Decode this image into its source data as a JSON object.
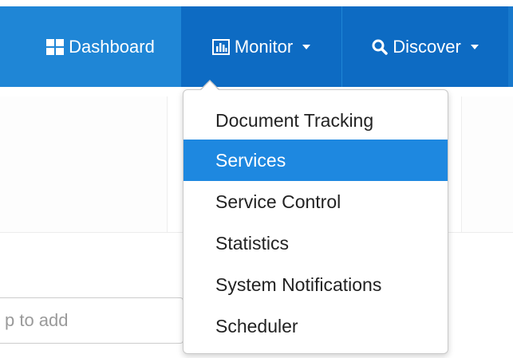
{
  "navbar": {
    "items": [
      {
        "label": "Dashboard",
        "icon": "grid-icon"
      },
      {
        "label": "Monitor",
        "icon": "bar-chart-icon"
      },
      {
        "label": "Discover",
        "icon": "search-icon"
      }
    ],
    "background": "#1f86d6",
    "active_background": "#0d6bc3"
  },
  "monitor_menu": {
    "items": [
      {
        "label": "Document Tracking"
      },
      {
        "label": "Services",
        "active": true
      },
      {
        "label": "Service Control"
      },
      {
        "label": "Statistics"
      },
      {
        "label": "System Notifications"
      },
      {
        "label": "Scheduler"
      }
    ],
    "active_color": "#1e88e0"
  },
  "content": {
    "input_placeholder": "p to add"
  }
}
